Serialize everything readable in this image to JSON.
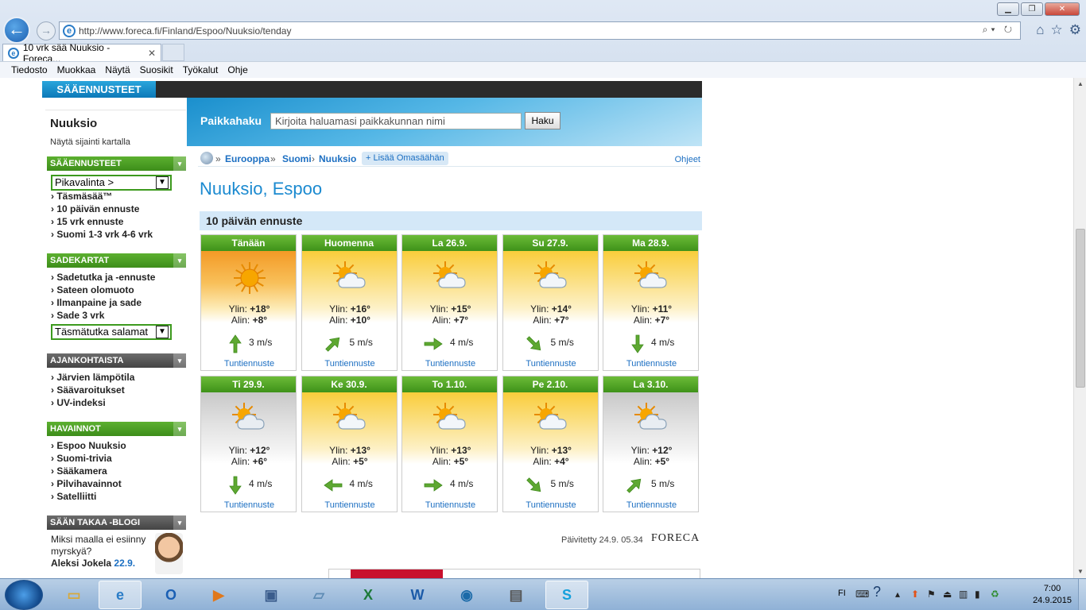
{
  "browser": {
    "url": "http://www.foreca.fi/Finland/Espoo/Nuuksio/tenday",
    "tab_title": "10 vrk sää Nuuksio - Foreca...",
    "menu": [
      "Tiedosto",
      "Muokkaa",
      "Näytä",
      "Suosikit",
      "Työkalut",
      "Ohje"
    ]
  },
  "site": {
    "section_tab": "SÄÄENNUSTEET",
    "search": {
      "label": "Paikkahaku",
      "placeholder": "Kirjoita haluamasi paikkakunnan nimi",
      "button": "Haku"
    },
    "location": {
      "name": "Nuuksio",
      "map_link": "Näytä sijainti kartalla"
    },
    "sections": {
      "forecasts": {
        "title": "SÄÄENNUSTEET",
        "select": "Pikavalinta >",
        "links": [
          "Täsmäsää™",
          "10 päivän ennuste",
          "15 vrk ennuste",
          "Suomi  1-3 vrk   4-6 vrk"
        ]
      },
      "rain": {
        "title": "SADEKARTAT",
        "links": [
          "Sadetutka ja -ennuste",
          "Sateen olomuoto",
          "Ilmanpaine ja sade",
          "Sade 3 vrk"
        ],
        "select": "Täsmätutka salamat"
      },
      "current": {
        "title": "AJANKOHTAISTA",
        "links": [
          "Järvien lämpötila",
          "Säävaroitukset",
          "UV-indeksi"
        ]
      },
      "observations": {
        "title": "HAVAINNOT",
        "links": [
          "Espoo Nuuksio",
          "Suomi-trivia",
          "Sääkamera",
          "Pilvihavainnot",
          "Satelliitti"
        ]
      },
      "blog": {
        "title": "SÄÄN TAKAA -BLOGI",
        "line1": "Miksi maalla ei esiinny",
        "line2": "myrskyä?",
        "author": "Aleksi Jokela",
        "date": "22.9."
      }
    },
    "breadcrumb": {
      "items": [
        "Eurooppa",
        "Suomi",
        "Nuuksio"
      ],
      "add": "+ Lisää Omasäähän",
      "help": "Ohjeet"
    },
    "page_title": "Nuuksio, Espoo",
    "forecast_header": "10 päivän ennuste",
    "high_label": "Ylin:",
    "low_label": "Alin:",
    "hourly_link": "Tuntiennuste",
    "days": [
      {
        "day": "Tänään",
        "high": "+18°",
        "low": "+8°",
        "wind": "3 m/s",
        "dir": "N",
        "icon": "sun-icon",
        "bg": "orange"
      },
      {
        "day": "Huomenna",
        "high": "+16°",
        "low": "+10°",
        "wind": "5 m/s",
        "dir": "NE",
        "icon": "partly-cloudy-icon",
        "bg": "yellow"
      },
      {
        "day": "La 26.9.",
        "high": "+15°",
        "low": "+7°",
        "wind": "4 m/s",
        "dir": "E",
        "icon": "partly-cloudy-icon",
        "bg": "yellow"
      },
      {
        "day": "Su 27.9.",
        "high": "+14°",
        "low": "+7°",
        "wind": "5 m/s",
        "dir": "SE",
        "icon": "partly-cloudy-icon",
        "bg": "yellow"
      },
      {
        "day": "Ma 28.9.",
        "high": "+11°",
        "low": "+7°",
        "wind": "4 m/s",
        "dir": "S",
        "icon": "partly-cloudy-icon",
        "bg": "yellow"
      },
      {
        "day": "Ti 29.9.",
        "high": "+12°",
        "low": "+6°",
        "wind": "4 m/s",
        "dir": "S",
        "icon": "cloudy-sun-icon",
        "bg": "grey"
      },
      {
        "day": "Ke 30.9.",
        "high": "+13°",
        "low": "+5°",
        "wind": "4 m/s",
        "dir": "W",
        "icon": "partly-cloudy-icon",
        "bg": "yellow"
      },
      {
        "day": "To 1.10.",
        "high": "+13°",
        "low": "+5°",
        "wind": "4 m/s",
        "dir": "E",
        "icon": "partly-cloudy-icon",
        "bg": "yellow"
      },
      {
        "day": "Pe 2.10.",
        "high": "+13°",
        "low": "+4°",
        "wind": "5 m/s",
        "dir": "SE",
        "icon": "partly-cloudy-icon",
        "bg": "yellow"
      },
      {
        "day": "La 3.10.",
        "high": "+12°",
        "low": "+5°",
        "wind": "5 m/s",
        "dir": "NE",
        "icon": "cloudy-sun-icon",
        "bg": "grey"
      }
    ],
    "updated": "Päivitetty 24.9. 05.34",
    "brand": "FORECA"
  },
  "taskbar": {
    "lang": "FI",
    "time": "7:00",
    "date": "24.9.2015"
  }
}
